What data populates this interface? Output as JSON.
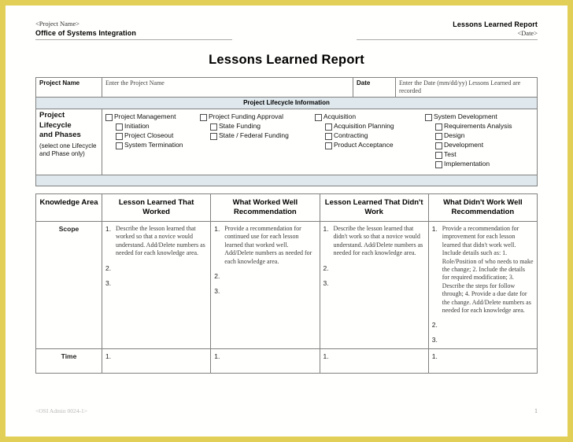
{
  "header": {
    "left_line1": "<Project Name>",
    "left_line2": "Office of Systems Integration",
    "right_line1": "Lessons Learned Report",
    "right_line2": "<Date>"
  },
  "doc_title": "Lessons Learned Report",
  "project_row": {
    "name_label": "Project Name",
    "name_value": "Enter the Project Name",
    "date_label": "Date",
    "date_value": "Enter the Date (mm/dd/yy) Lessons Learned are recorded"
  },
  "lifecycle": {
    "band_title": "Project Lifecycle Information",
    "label_line1": "Project",
    "label_line2": "Lifecycle",
    "label_line3": "and Phases",
    "label_note": "(select one Lifecycle and Phase only)",
    "columns": [
      {
        "heading": "Project Management",
        "items": [
          "Initiation",
          "Project Closeout",
          "System Termination"
        ]
      },
      {
        "heading": "Project Funding Approval",
        "items": [
          "State Funding",
          "State / Federal Funding"
        ]
      },
      {
        "heading": "Acquisition",
        "items": [
          "Acquisition Planning",
          "Contracting",
          "Product Acceptance"
        ]
      },
      {
        "heading": "System Development",
        "items": [
          "Requirements Analysis",
          "Design",
          "Development",
          "Test",
          "Implementation"
        ]
      }
    ]
  },
  "matrix": {
    "columns": [
      "Knowledge Area",
      "Lesson Learned That Worked",
      "What Worked Well Recommendation",
      "Lesson Learned That Didn't Work",
      "What Didn't Work Well Recommendation"
    ],
    "rows": [
      {
        "area": "Scope",
        "cells": [
          {
            "items": [
              "Describe the lesson learned that worked so that a novice would understand. Add/Delete numbers as needed for each knowledge area.",
              "",
              ""
            ]
          },
          {
            "items": [
              "Provide a recommendation for continued use for each lesson learned that worked well. Add/Delete numbers as needed for each knowledge area.",
              "",
              ""
            ]
          },
          {
            "items": [
              "Describe the lesson learned that didn't work so that a novice would understand. Add/Delete numbers as needed for each knowledge area.",
              "",
              ""
            ]
          },
          {
            "items": [
              "Provide a recommendation for improvement for each lesson learned that didn't work well. Include details such as: 1. Role/Position of who needs to make the change; 2. Include the details for required modification; 3. Describe the steps for follow through; 4. Provide a due date for the change. Add/Delete numbers as needed for each knowledge area.",
              "",
              ""
            ]
          }
        ]
      },
      {
        "area": "Time",
        "cells": [
          {
            "items": [
              ""
            ]
          },
          {
            "items": [
              ""
            ]
          },
          {
            "items": [
              ""
            ]
          },
          {
            "items": [
              ""
            ]
          }
        ]
      }
    ],
    "numerals": [
      "1.",
      "2.",
      "3."
    ]
  },
  "footer": {
    "left": "<OSI Admin 0024-1>",
    "page": "1"
  },
  "colors": {
    "band": "#dfe9ed",
    "frame": "#e2cf57",
    "rule": "#808080"
  }
}
